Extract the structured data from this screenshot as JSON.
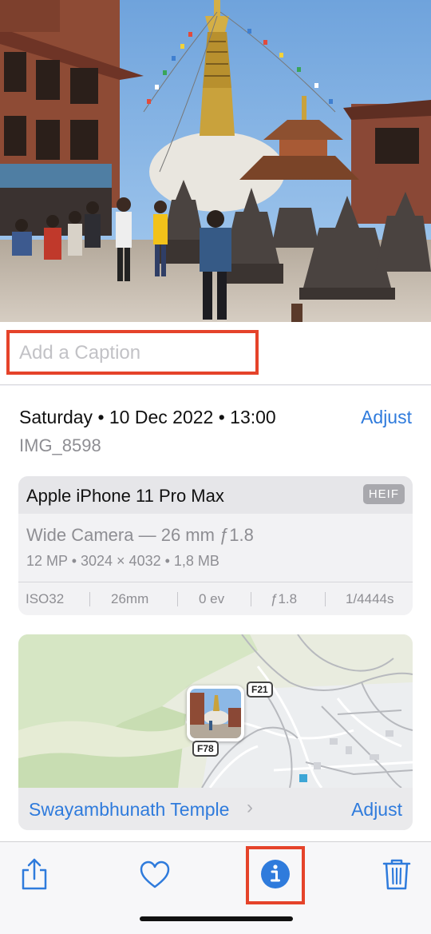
{
  "caption": {
    "placeholder": "Add a Caption"
  },
  "meta": {
    "date": "Saturday • 10 Dec 2022 • 13:00",
    "adjust_label": "Adjust",
    "filename": "IMG_8598"
  },
  "device_card": {
    "device": "Apple iPhone 11 Pro Max",
    "format_badge": "HEIF",
    "camera": "Wide Camera — 26 mm ƒ1.8",
    "specs": "12 MP  •  3024 × 4032  •  1,8 MB",
    "exif": [
      "ISO32",
      "26mm",
      "0 ev",
      "ƒ1.8",
      "1/4444s"
    ]
  },
  "location": {
    "place": "Swayambhunath Temple",
    "adjust_label": "Adjust",
    "road_labels": [
      "F21",
      "F78"
    ]
  },
  "toolbar": {
    "share_icon": "share-icon",
    "favorite_icon": "heart-icon",
    "info_icon": "info-icon",
    "delete_icon": "trash-icon"
  },
  "colors": {
    "accent": "#2f7bdc",
    "highlight": "#e5432a"
  }
}
